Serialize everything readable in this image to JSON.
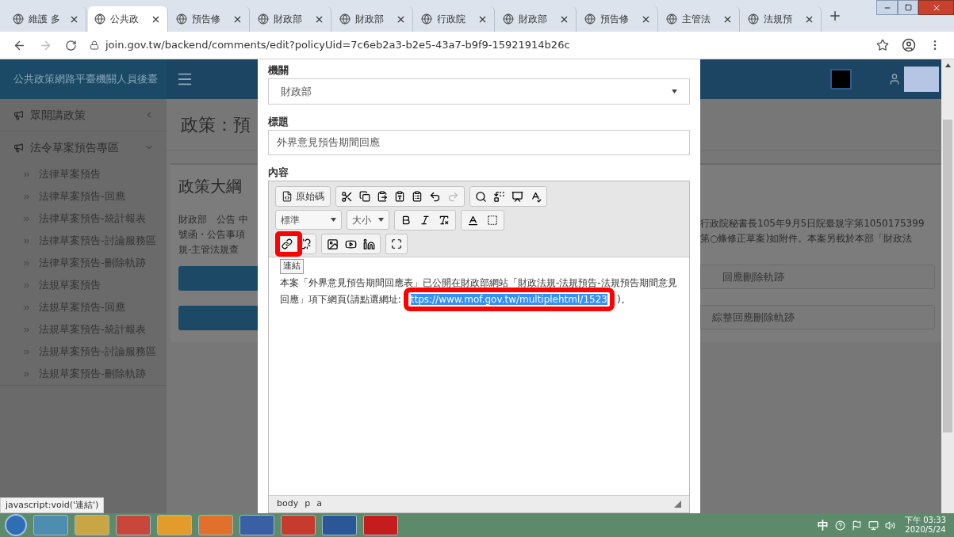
{
  "browser": {
    "tabs": [
      {
        "label": "維護 多",
        "selected": false
      },
      {
        "label": "公共政",
        "selected": true
      },
      {
        "label": "預告修",
        "selected": false
      },
      {
        "label": "財政部",
        "selected": false
      },
      {
        "label": "財政部",
        "selected": false
      },
      {
        "label": "行政院",
        "selected": false
      },
      {
        "label": "財政部",
        "selected": false
      },
      {
        "label": "預告修",
        "selected": false
      },
      {
        "label": "主管法",
        "selected": false
      },
      {
        "label": "法規預",
        "selected": false
      }
    ],
    "url": "join.gov.tw/backend/comments/edit?policyUid=7c6eb2a3-b2e5-43a7-b9f9-15921914b26c"
  },
  "sidebar": {
    "title": "公共政策網路平臺機關人員後臺",
    "sections": [
      {
        "label": "眾開講政策",
        "expanded": false
      },
      {
        "label": "法令草案預告專區",
        "expanded": true,
        "children": [
          "法律草案預告",
          "法律草案預告-回應",
          "法律草案預告-統計報表",
          "法律草案預告-討論服務區",
          "法律草案預告-刪除軌跡",
          "法規草案預告",
          "法規草案預告-回應",
          "法規草案預告-統計報表",
          "法規草案預告-討論服務區",
          "法規草案預告-刪除軌跡"
        ]
      }
    ]
  },
  "page": {
    "title": "政策：預",
    "card_title": "政策大綱",
    "text_left": [
      "財政部　公告 中",
      "號函・公告事項",
      "規-主管法規查"
    ],
    "text_right": [
      "行政院秘書長105年9月5日院臺規字第1050175399",
      "第○條修正草案)如附件。本案另載於本部「財政法"
    ],
    "buttons_right": [
      "回應刪除軌跡",
      "綜整回應刪除軌跡"
    ]
  },
  "modal": {
    "fields": [
      {
        "label": "機關",
        "kind": "select",
        "value": "財政部"
      },
      {
        "label": "標題",
        "kind": "text",
        "value": "外界意見預告期間回應"
      }
    ],
    "editor": {
      "label": "內容",
      "source_button": "原始碼",
      "format": "標準",
      "size": "大小",
      "tooltip": "連結",
      "content": "本案「外界意見預告期間回應表」已公開在財政部網站「財政法規-法規預告-法規預告期間意見回應」項下網頁(請點選網址:",
      "link": "ttps://www.mof.gov.tw/multiplehtml/1523",
      "link_selected": true,
      "content_end": ")。",
      "path": [
        "body",
        "p",
        "a"
      ]
    }
  },
  "status_url": "javascript:void('連結')",
  "taskbar": {
    "ime": "中",
    "time": "下午 03:33",
    "date": "2020/5/24"
  }
}
